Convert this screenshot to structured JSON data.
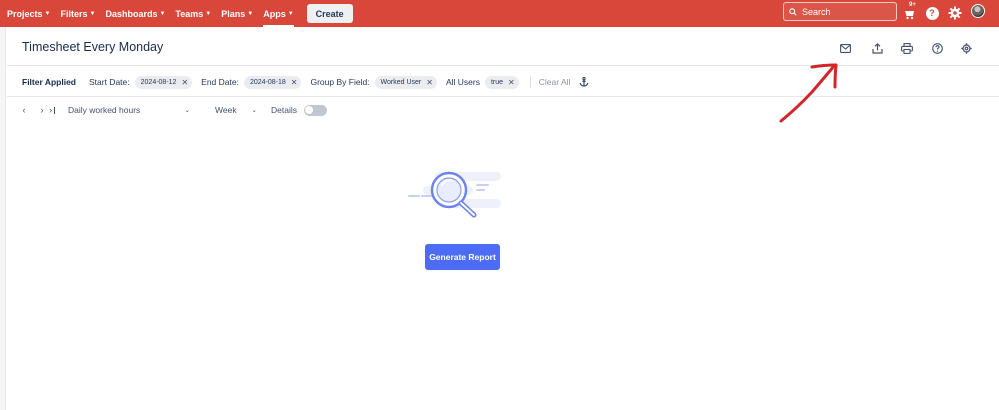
{
  "colors": {
    "brand": "#d9473a",
    "accent": "#4c6cf6",
    "annotation": "#d4262a"
  },
  "topnav": {
    "items": [
      {
        "label": "Projects",
        "icon": "chevron-down-icon"
      },
      {
        "label": "Filters",
        "icon": "chevron-down-icon"
      },
      {
        "label": "Dashboards",
        "icon": "chevron-down-icon"
      },
      {
        "label": "Teams",
        "icon": "chevron-down-icon"
      },
      {
        "label": "Plans",
        "icon": "chevron-down-icon"
      },
      {
        "label": "Apps",
        "icon": "chevron-down-icon",
        "active": true
      }
    ],
    "create_label": "Create",
    "search_placeholder": "Search",
    "notification_badge": "9+",
    "icons": [
      "search-icon",
      "notifications-icon",
      "help-icon",
      "settings-icon",
      "avatar"
    ]
  },
  "page": {
    "title": "Timesheet Every Monday",
    "header_icons": [
      "email-icon",
      "export-icon",
      "print-icon",
      "help-icon",
      "settings-icon"
    ]
  },
  "filters": {
    "applied_label": "Filter Applied",
    "start_label": "Start Date:",
    "start_value": "2024-08-12",
    "end_label": "End Date:",
    "end_value": "2024-08-18",
    "group_label": "Group By Field:",
    "group_value": "Worked User",
    "users_label": "All Users",
    "users_value": "true",
    "clear_all": "Clear All",
    "anchor_icon": "anchor-icon"
  },
  "toolbar": {
    "report_type": "Daily worked hours",
    "period": "Week",
    "details_label": "Details",
    "details_on": false
  },
  "empty_state": {
    "illustration": "magnifier-illustration",
    "button_label": "Generate Report"
  }
}
